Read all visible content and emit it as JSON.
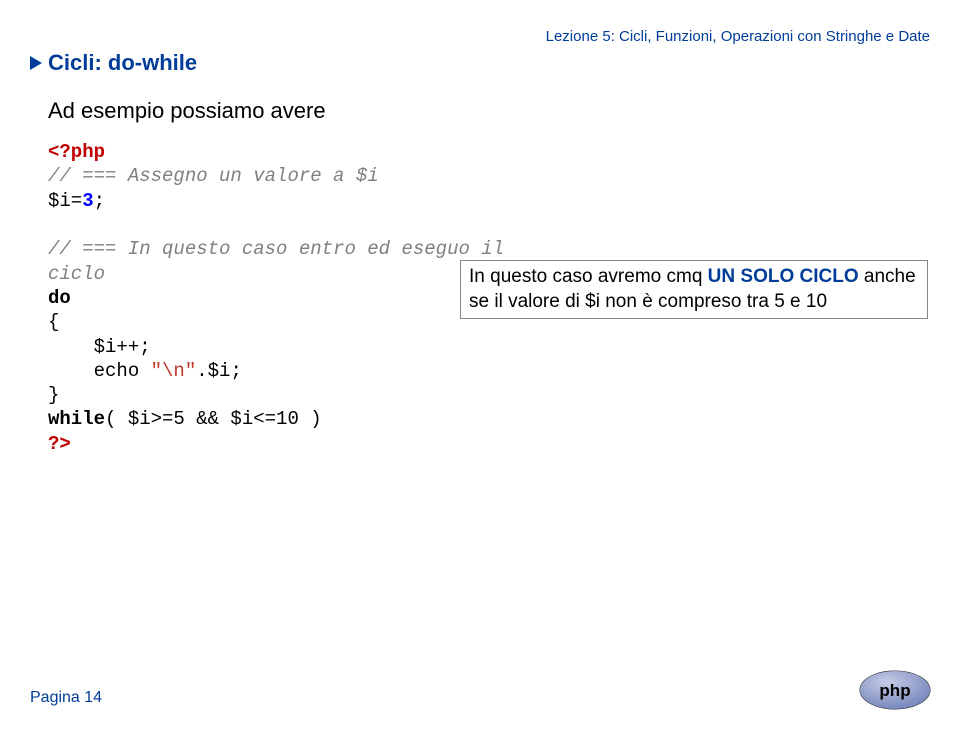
{
  "header": "Lezione 5: Cicli, Funzioni, Operazioni con Stringhe e Date",
  "section": "Cicli: do-while",
  "intro": "Ad esempio possiamo avere",
  "code": {
    "open": "<?php",
    "cmt1": "// === Assegno un valore a $i",
    "l1a": "$i=",
    "l1b": "3",
    "l1c": ";",
    "cmt2": "// === In questo caso entro ed eseguo il",
    "cmt2b": "ciclo",
    "kw_do": "do",
    "brace_open": "{",
    "body1": "    $i++;",
    "body2a": "    echo ",
    "body2b": "\"\\n\"",
    "body2c": ".$i;",
    "brace_close": "}",
    "kw_while": "while",
    "while_cond": "( $i>=5 && $i<=10 )",
    "close": "?>"
  },
  "callout": {
    "t1": "In questo caso avremo cmq ",
    "t2": "UN SOLO CICLO",
    "t3": " anche se il valore di $i non è compreso tra 5 e 10"
  },
  "page": "Pagina 14"
}
